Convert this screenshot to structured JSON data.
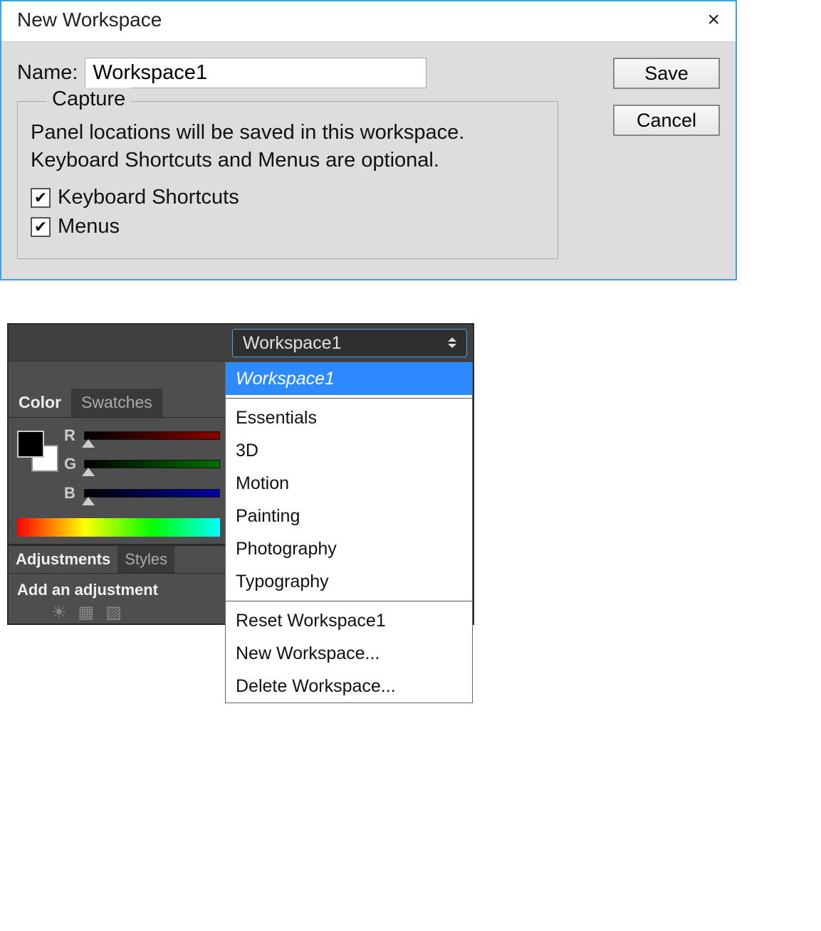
{
  "dialog": {
    "title": "New Workspace",
    "close_icon": "×",
    "name_label": "Name:",
    "name_value": "Workspace1",
    "save_label": "Save",
    "cancel_label": "Cancel",
    "capture": {
      "legend": "Capture",
      "description": "Panel locations will be saved in this workspace. Keyboard Shortcuts and Menus are optional.",
      "checkboxes": [
        {
          "label": "Keyboard Shortcuts",
          "checked": true
        },
        {
          "label": "Menus",
          "checked": true
        }
      ]
    }
  },
  "panel": {
    "switcher_value": "Workspace1",
    "color_tab": "Color",
    "swatches_tab": "Swatches",
    "channels": {
      "r": "R",
      "g": "G",
      "b": "B"
    },
    "adjustments_tab": "Adjustments",
    "styles_tab": "Styles",
    "add_adjustment": "Add an adjustment",
    "menu": {
      "items_top": [
        "Workspace1"
      ],
      "items_presets": [
        "Essentials",
        "3D",
        "Motion",
        "Painting",
        "Photography",
        "Typography"
      ],
      "items_bottom": [
        "Reset Workspace1",
        "New Workspace...",
        "Delete Workspace..."
      ]
    }
  }
}
